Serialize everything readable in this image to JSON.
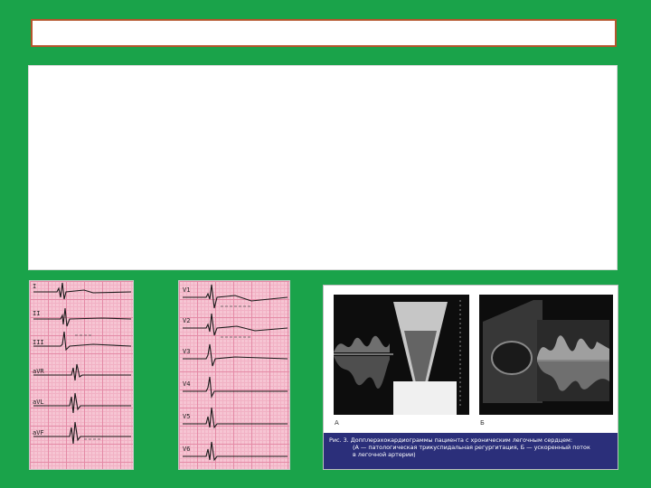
{
  "slide": {
    "title": "",
    "body": ""
  },
  "ecg_left": {
    "leads": [
      "I",
      "II",
      "III",
      "aVR",
      "aVL",
      "aVF"
    ]
  },
  "ecg_right": {
    "leads": [
      "V1",
      "V2",
      "V3",
      "V4",
      "V5",
      "V6"
    ]
  },
  "echo": {
    "label_a": "А",
    "label_b": "Б",
    "caption_line1": "Рис. 3. Допплерэхокардиограммы пациента с хроническим легочным сердцем:",
    "caption_line2": "(А — патологическая трикуспидальная регургитация, Б — ускоренный поток",
    "caption_line3": "в легочной артерии)"
  },
  "colors": {
    "background": "#1aa34a",
    "title_border": "#b4552d",
    "caption_bg": "#2b2f7a",
    "ecg_paper": "#f6c5d3"
  }
}
